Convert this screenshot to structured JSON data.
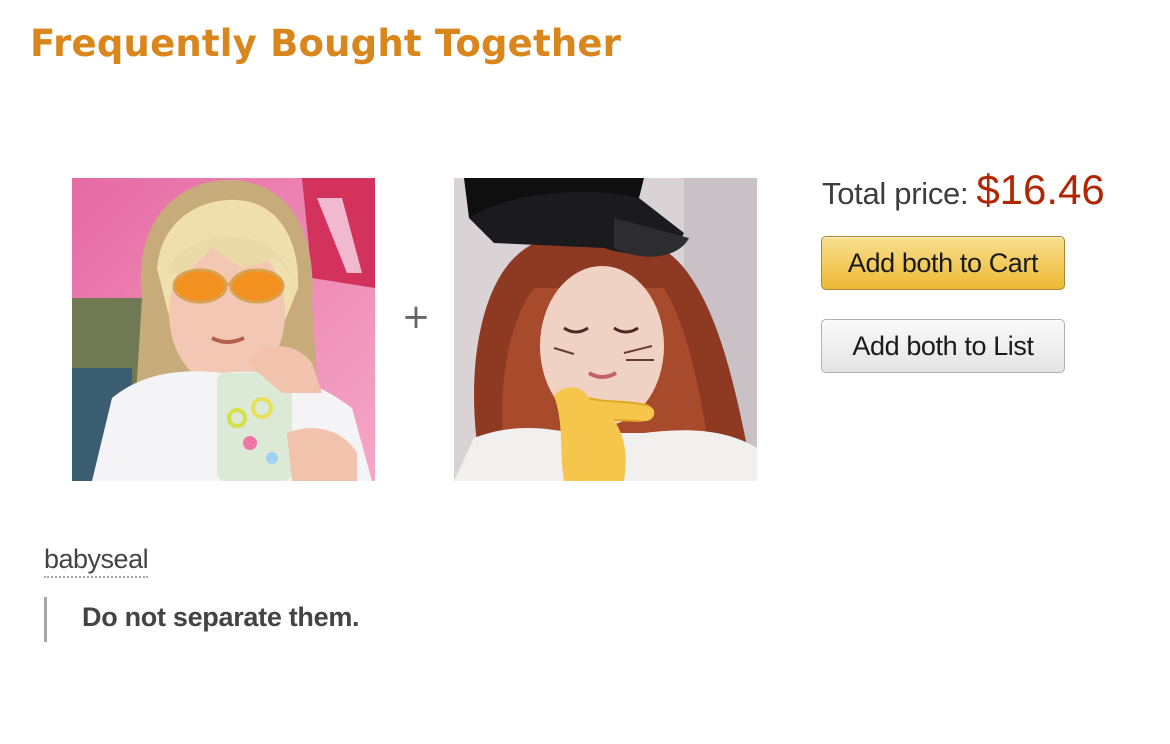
{
  "header": {
    "title": "Frequently Bought Together"
  },
  "bundle": {
    "plus_sign": "+",
    "items": [
      {
        "image_alt_icon": "product-photo-person-orange-sunglasses"
      },
      {
        "image_alt_icon": "product-photo-person-black-cap-thinking-emoji"
      }
    ],
    "total_label": "Total price:",
    "total_price": "$16.46",
    "add_to_cart_label": "Add both to Cart",
    "add_to_list_label": "Add both to List"
  },
  "post": {
    "username": "babyseal",
    "quote": "Do not separate them."
  },
  "colors": {
    "heading": "#d9861c",
    "price": "#b12704",
    "cart_button": "#f0c14b",
    "list_button": "#e7e9ec"
  }
}
